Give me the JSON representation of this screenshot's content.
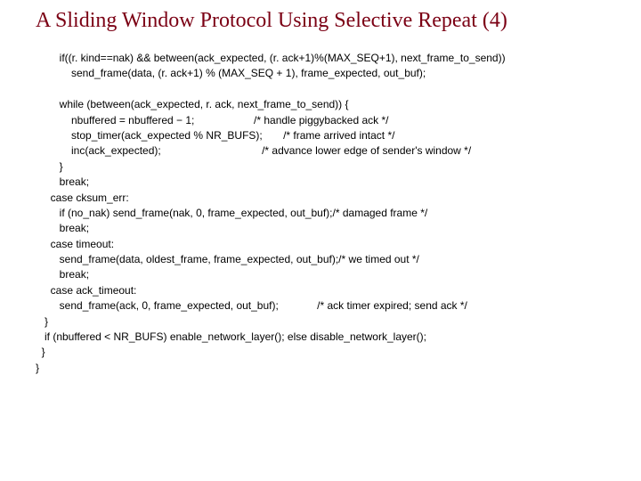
{
  "title": "A Sliding Window Protocol Using Selective Repeat (4)",
  "code": {
    "l01": "        if((r. kind==nak) && between(ack_expected, (r. ack+1)%(MAX_SEQ+1), next_frame_to_send))",
    "l02": "            send_frame(data, (r. ack+1) % (MAX_SEQ + 1), frame_expected, out_buf);",
    "l03": "",
    "l04": "        while (between(ack_expected, r. ack, next_frame_to_send)) {",
    "l05": "            nbuffered = nbuffered − 1;                    /* handle piggybacked ack */",
    "l06": "            stop_timer(ack_expected % NR_BUFS);       /* frame arrived intact */",
    "l07": "            inc(ack_expected);                                  /* advance lower edge of sender's window */",
    "l08": "        }",
    "l09": "        break;",
    "l10": "     case cksum_err:",
    "l11": "        if (no_nak) send_frame(nak, 0, frame_expected, out_buf);/* damaged frame */",
    "l12": "        break;",
    "l13": "     case timeout:",
    "l14": "        send_frame(data, oldest_frame, frame_expected, out_buf);/* we timed out */",
    "l15": "        break;",
    "l16": "     case ack_timeout:",
    "l17": "        send_frame(ack, 0, frame_expected, out_buf);             /* ack timer expired; send ack */",
    "l18": "   }",
    "l19": "   if (nbuffered < NR_BUFS) enable_network_layer(); else disable_network_layer();",
    "l20": "  }",
    "l21": "}"
  }
}
